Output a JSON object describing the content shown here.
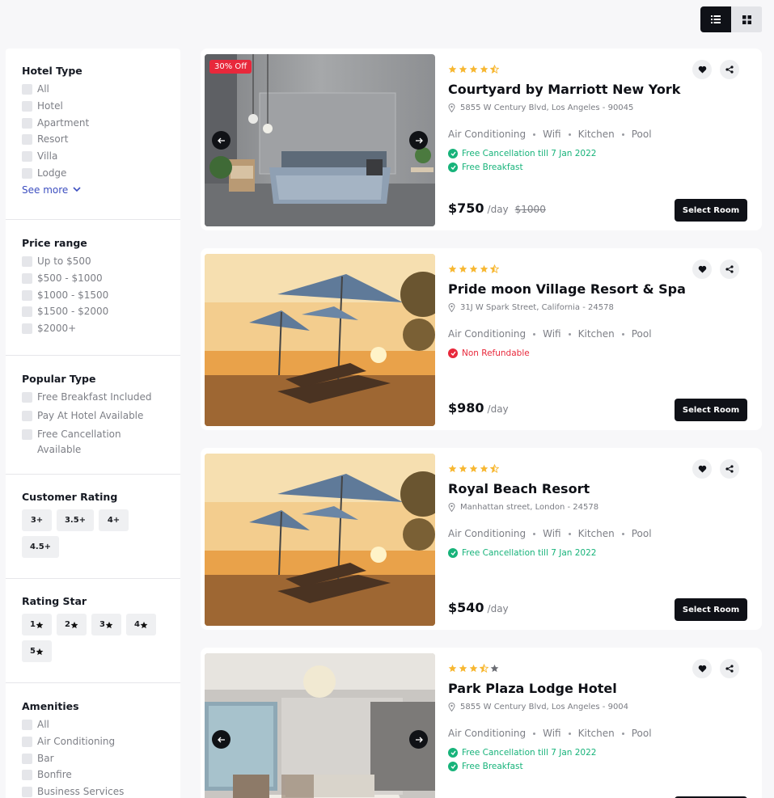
{
  "view_toggle": {
    "active": "list",
    "icons": [
      "list-view-icon",
      "grid-view-icon"
    ]
  },
  "filters": {
    "hotel_type": {
      "title": "Hotel Type",
      "options": [
        "All",
        "Hotel",
        "Apartment",
        "Resort",
        "Villa",
        "Lodge"
      ],
      "see_more": "See more"
    },
    "price_range": {
      "title": "Price range",
      "options": [
        "Up to $500",
        "$500 - $1000",
        "$1000 - $1500",
        "$1500 - $2000",
        "$2000+"
      ]
    },
    "popular_type": {
      "title": "Popular Type",
      "options": [
        "Free Breakfast Included",
        "Pay At Hotel Available",
        "Free Cancellation Available"
      ]
    },
    "customer_rating": {
      "title": "Customer Rating",
      "options": [
        "3+",
        "3.5+",
        "4+",
        "4.5+"
      ]
    },
    "rating_star": {
      "title": "Rating Star",
      "options": [
        "1",
        "2",
        "3",
        "4",
        "5"
      ]
    },
    "amenities": {
      "title": "Amenities",
      "options": [
        "All",
        "Air Conditioning",
        "Bar",
        "Bonfire",
        "Business Services"
      ]
    }
  },
  "hotels": [
    {
      "name": "Courtyard by Marriott New York",
      "address": "5855 W Century Blvd, Los Angeles - 90045",
      "rating": 4.5,
      "discount_badge": "30% Off",
      "amenities": [
        "Air Conditioning",
        "Wifi",
        "Kitchen",
        "Pool"
      ],
      "perks": [
        {
          "text": "Free Cancellation till 7 Jan 2022",
          "type": "ok"
        },
        {
          "text": "Free Breakfast",
          "type": "ok"
        }
      ],
      "price": "$750",
      "per": "/day",
      "old_price": "$1000",
      "select_label": "Select Room",
      "photo": "bedroom"
    },
    {
      "name": "Pride moon Village Resort & Spa",
      "address": "31J W Spark Street, California - 24578",
      "rating": 4.5,
      "amenities": [
        "Air Conditioning",
        "Wifi",
        "Kitchen",
        "Pool"
      ],
      "perks": [
        {
          "text": "Non Refundable",
          "type": "bad"
        }
      ],
      "price": "$980",
      "per": "/day",
      "select_label": "Select Room",
      "photo": "beach"
    },
    {
      "name": "Royal Beach Resort",
      "address": "Manhattan street, London - 24578",
      "rating": 4.5,
      "amenities": [
        "Air Conditioning",
        "Wifi",
        "Kitchen",
        "Pool"
      ],
      "perks": [
        {
          "text": "Free Cancellation till 7 Jan 2022",
          "type": "ok"
        }
      ],
      "price": "$540",
      "per": "/day",
      "select_label": "Select Room",
      "photo": "beach"
    },
    {
      "name": "Park Plaza Lodge Hotel",
      "address": "5855 W Century Blvd, Los Angeles - 9004",
      "rating": 3.5,
      "amenities": [
        "Air Conditioning",
        "Wifi",
        "Kitchen",
        "Pool"
      ],
      "perks": [
        {
          "text": "Free Cancellation till 7 Jan 2022",
          "type": "ok"
        },
        {
          "text": "Free Breakfast",
          "type": "ok"
        }
      ],
      "price": "",
      "per": "",
      "select_label": "",
      "photo": "luxury"
    }
  ],
  "colors": {
    "star": "#f7b731",
    "ok": "#17b37a",
    "bad": "#e8283b",
    "dark": "#0f1117"
  }
}
